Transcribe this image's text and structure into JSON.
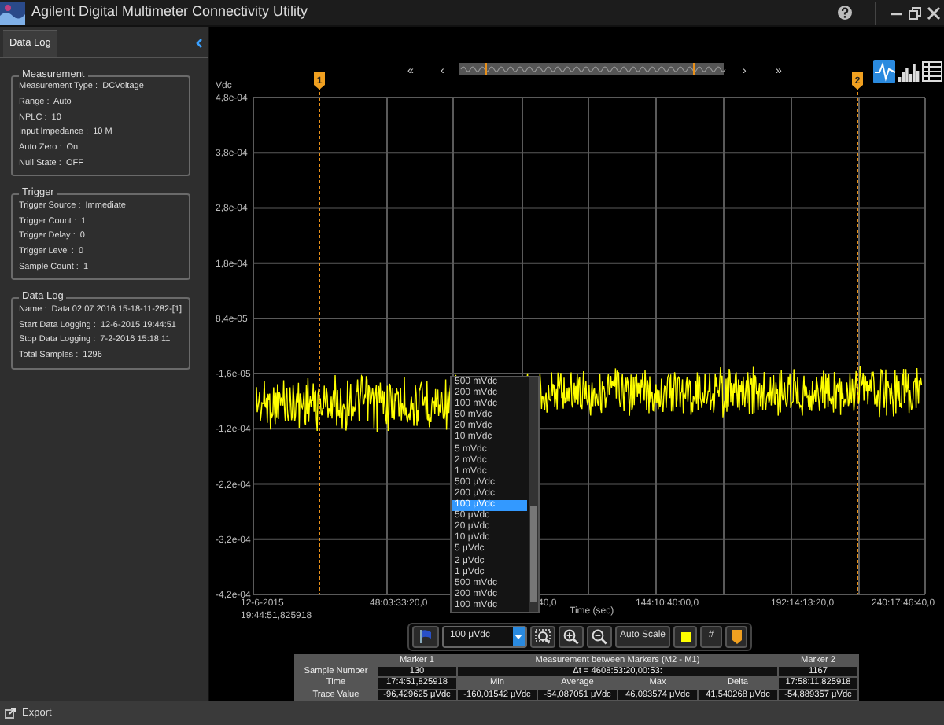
{
  "window": {
    "title": "Agilent Digital Multimeter Connectivity Utility"
  },
  "sidebar": {
    "tab": {
      "label": "Data Log",
      "selected": true
    },
    "groups": [
      {
        "title": "Measurement",
        "fields": [
          {
            "label": "Measurement Type :",
            "value": "DCVoltage"
          },
          {
            "label": "Range :",
            "value": "Auto"
          },
          {
            "label": "NPLC :",
            "value": "10"
          },
          {
            "label": "Input Impedance :",
            "value": "10 M"
          },
          {
            "label": "Auto Zero :",
            "value": "On"
          },
          {
            "label": "Null State :",
            "value": "OFF"
          }
        ]
      },
      {
        "title": "Trigger",
        "fields": [
          {
            "label": "Trigger Source :",
            "value": "Immediate"
          },
          {
            "label": "Trigger Count :",
            "value": "1"
          },
          {
            "label": "Trigger Delay :",
            "value": "0"
          },
          {
            "label": "Trigger Level :",
            "value": "0"
          },
          {
            "label": "Sample Count :",
            "value": "1"
          }
        ]
      },
      {
        "title": "Data Log",
        "fields": [
          {
            "label": "Name :",
            "value": "Data 02 07 2016 15-18-11-282-[1]"
          },
          {
            "label": "Start Data Logging :",
            "value": "12-6-2015 19:44:51"
          },
          {
            "label": "Stop Data Logging :",
            "value": "7-2-2016 15:18:11"
          },
          {
            "label": "Total Samples :",
            "value": "1296"
          }
        ]
      }
    ]
  },
  "view_modes": [
    {
      "kind": "trace",
      "selected": true
    },
    {
      "kind": "histogram",
      "selected": false
    },
    {
      "kind": "table",
      "selected": false
    }
  ],
  "navigator": {
    "buttons": [
      "«",
      "‹",
      "›",
      "»"
    ]
  },
  "chart": {
    "y_unit": "Vdc",
    "y_ticks": [
      "4,8e-04",
      "3,8e-04",
      "2,8e-04",
      "1,8e-04",
      "8,4e-05",
      "-1,6e-05",
      "-1,2e-04",
      "-2,2e-04",
      "-3,2e-04",
      "-4,2e-04"
    ],
    "x_ticks": [
      {
        "label": "12-6-2015",
        "sublabel": "19:44:51,825918"
      },
      {
        "label": "48:03:33:20,0"
      },
      {
        "label": "40,0"
      },
      {
        "label": "144:10:40:00,0"
      },
      {
        "label": "192:14:13:20,0"
      },
      {
        "label": "240:17:46:40,0"
      }
    ],
    "x_title": "Time (sec)",
    "markers": [
      "1",
      "2"
    ]
  },
  "range_dropdown": {
    "options": [
      {
        "label": "500 mVdc",
        "selected": false
      },
      {
        "label": "200 mVdc",
        "selected": false
      },
      {
        "label": "100 mVdc",
        "selected": false
      },
      {
        "label": "50 mVdc",
        "selected": false
      },
      {
        "label": "20 mVdc",
        "selected": false
      },
      {
        "label": "10 mVdc",
        "selected": false
      },
      {
        "label": "5 mVdc",
        "selected": false
      },
      {
        "label": "2 mVdc",
        "selected": false
      },
      {
        "label": "1 mVdc",
        "selected": false
      },
      {
        "label": "500 μVdc",
        "selected": false
      },
      {
        "label": "200 μVdc",
        "selected": false
      },
      {
        "label": "100 μVdc",
        "selected": true
      },
      {
        "label": "50 μVdc",
        "selected": false
      },
      {
        "label": "20 μVdc",
        "selected": false
      },
      {
        "label": "10 μVdc",
        "selected": false
      },
      {
        "label": "5 μVdc",
        "selected": false
      },
      {
        "label": "2 μVdc",
        "selected": false
      },
      {
        "label": "1 μVdc",
        "selected": false
      },
      {
        "label": "500 mVdc",
        "selected": false
      },
      {
        "label": "200 mVdc",
        "selected": false
      },
      {
        "label": "100 mVdc",
        "selected": false
      }
    ]
  },
  "toolbar": [
    {
      "kind": "flag"
    },
    {
      "kind": "select",
      "value": "100 μVdc"
    },
    {
      "kind": "zoom-box"
    },
    {
      "kind": "zoom-in"
    },
    {
      "kind": "zoom-out"
    },
    {
      "kind": "text",
      "label": "Auto Scale"
    },
    {
      "kind": "color",
      "color": "#ffff00"
    },
    {
      "kind": "text",
      "label": "#"
    },
    {
      "kind": "marker"
    }
  ],
  "marker_table": {
    "columns": [
      "Marker 1",
      "Measurement between Markers (M2 - M1)",
      "Marker 2"
    ],
    "rows": [
      {
        "label": "Sample Number",
        "marker_1": "130",
        "span": "Δt = 4608:53:20,00:53:",
        "marker_2": "1167"
      },
      {
        "label": "Time",
        "marker_1": "17:4:51,825918",
        "cells": [
          "Min",
          "Average",
          "Max",
          "Delta"
        ],
        "marker_2": "17:58:11,825918"
      },
      {
        "label": "Trace Value",
        "marker_1": "-96,429625 μVdc",
        "cells": [
          "-160,01542 μVdc",
          "-54,087051 μVdc",
          "46,093574 μVdc",
          "41,540268 μVdc"
        ],
        "marker_2": "-54,889357 μVdc"
      }
    ]
  },
  "status_bar": {
    "export": "Export"
  }
}
